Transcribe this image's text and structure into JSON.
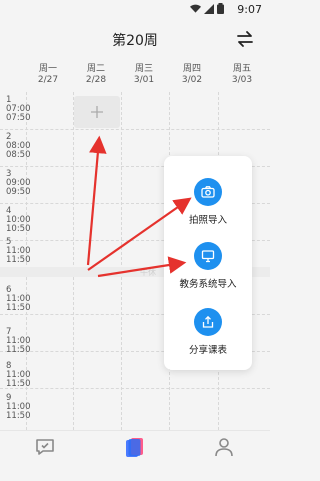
{
  "status": {
    "time": "9:07"
  },
  "header": {
    "title": "第20周"
  },
  "days": [
    {
      "name": "周一",
      "date": "2/27"
    },
    {
      "name": "周二",
      "date": "2/28"
    },
    {
      "name": "周三",
      "date": "3/01"
    },
    {
      "name": "周四",
      "date": "3/02"
    },
    {
      "name": "周五",
      "date": "3/03"
    }
  ],
  "periods": [
    {
      "num": "1",
      "start": "07:00",
      "end": "07:50"
    },
    {
      "num": "2",
      "start": "08:00",
      "end": "08:50"
    },
    {
      "num": "3",
      "start": "09:00",
      "end": "09:50"
    },
    {
      "num": "4",
      "start": "10:00",
      "end": "10:50"
    },
    {
      "num": "5",
      "start": "11:00",
      "end": "11:50"
    },
    {
      "num": "6",
      "start": "11:00",
      "end": "11:50"
    },
    {
      "num": "7",
      "start": "11:00",
      "end": "11:50"
    },
    {
      "num": "8",
      "start": "11:00",
      "end": "11:50"
    },
    {
      "num": "9",
      "start": "11:00",
      "end": "11:50"
    }
  ],
  "noon_label": "午休",
  "popup": {
    "photo_import": "拍照导入",
    "academic_import": "教务系统导入",
    "share_schedule": "分享课表"
  },
  "colors": {
    "accent": "#1e90ef",
    "arrow": "#e5322d"
  }
}
